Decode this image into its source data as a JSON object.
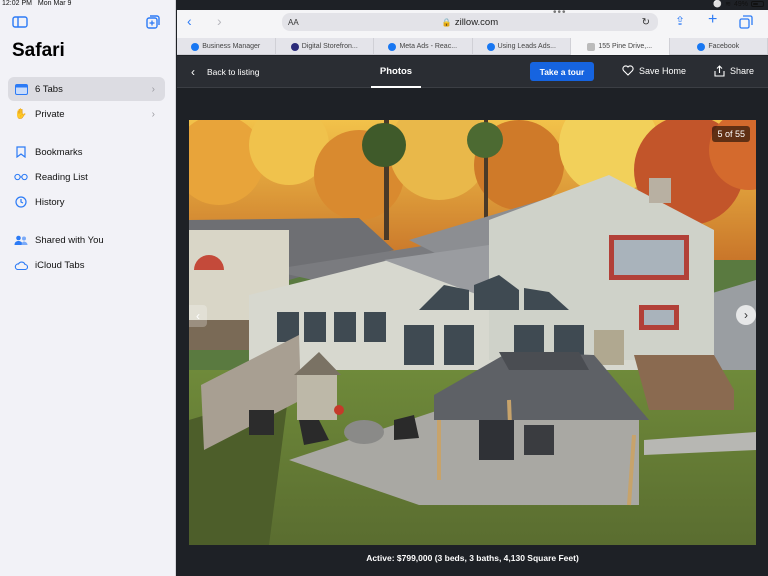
{
  "status": {
    "time": "12:02 PM",
    "date": "Mon Mar 9",
    "battery": "49%",
    "battery_level": 0.49
  },
  "sidebar": {
    "title": "Safari",
    "items": [
      {
        "label": "6 Tabs",
        "icon": "tabs-icon",
        "chevron": true,
        "active": true
      },
      {
        "label": "Private",
        "icon": "hand-icon",
        "chevron": true
      },
      {
        "label": "Bookmarks",
        "icon": "bookmark-icon"
      },
      {
        "label": "Reading List",
        "icon": "glasses-icon"
      },
      {
        "label": "History",
        "icon": "clock-icon"
      },
      {
        "label": "Shared with You",
        "icon": "people-icon"
      },
      {
        "label": "iCloud Tabs",
        "icon": "cloud-icon"
      }
    ]
  },
  "toolbar": {
    "url": "zillow.com",
    "aa": "AA"
  },
  "tabs": [
    {
      "label": "Business Manager",
      "color": "#1877f2"
    },
    {
      "label": "Digital Storefron...",
      "color": "#2b2b7a"
    },
    {
      "label": "Meta Ads - Reac...",
      "color": "#1877f2"
    },
    {
      "label": "Using Leads Ads...",
      "color": "#1877f2"
    },
    {
      "label": "155 Pine Drive,...",
      "color": "#888888",
      "active": true
    },
    {
      "label": "Facebook",
      "color": "#1877f2"
    }
  ],
  "header": {
    "back": "Back to listing",
    "photos": "Photos",
    "tour": "Take a tour",
    "save": "Save Home",
    "share": "Share"
  },
  "photo": {
    "counter": "5 of 55"
  },
  "caption": "Active: $799,000 (3 beds, 3 baths, 4,130 Square Feet)",
  "colors": {
    "accent": "#2c7bf6",
    "tour_button": "#1664e0",
    "header_bg": "#2a2d33"
  }
}
